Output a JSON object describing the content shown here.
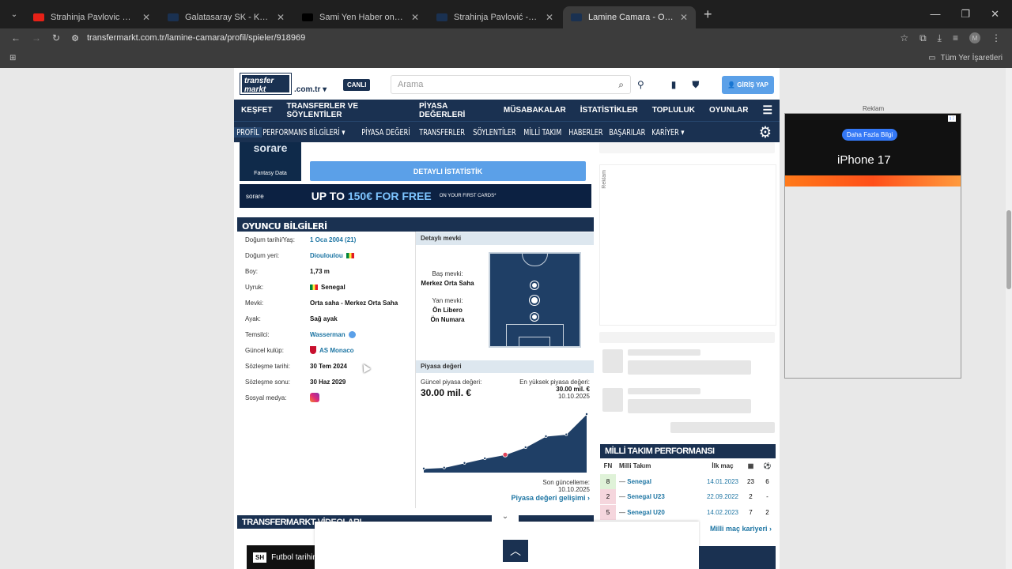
{
  "browser": {
    "tabs": [
      {
        "title": "Strahinja Pavlovic ● Welcome to",
        "fav_color": "#e62117",
        "active": false
      },
      {
        "title": "Galatasaray SK - Kulüp profili |",
        "fav_color": "#1a3151",
        "active": false
      },
      {
        "title": "Sami Yen Haber on X: \"Galatasa",
        "fav_color": "#000000",
        "active": false
      },
      {
        "title": "Strahinja Pavlović - Oyuncu pro",
        "fav_color": "#1a3151",
        "active": false
      },
      {
        "title": "Lamine Camara - Oyuncu profi",
        "fav_color": "#1a3151",
        "active": true
      }
    ],
    "url": "transfermarkt.com.tr/lamine-camara/profil/spieler/918969",
    "bookmarks_label": "Tüm Yer İşaretleri",
    "profile_initial": "M"
  },
  "header": {
    "logo_line1": "transfer",
    "logo_line2": "markt",
    "domain": ".com.tr",
    "live_badge": "CANLI",
    "search_placeholder": "Arama",
    "login_label": "GİRİŞ YAP"
  },
  "nav_main": [
    "KEŞFET",
    "TRANSFERLER VE SÖYLENTİLER",
    "PİYASA DEĞERLERİ",
    "MÜSABAKALAR",
    "İSTATİSTİKLER",
    "TOPLULUK",
    "OYUNLAR"
  ],
  "nav_sub": [
    "PROFİL",
    "PERFORMANS BİLGİLERİ ▾",
    "PİYASA DEĞERİ",
    "TRANSFERLER",
    "SÖYLENTİLER",
    "MİLLİ TAKIM",
    "HABERLER",
    "BAŞARILAR",
    "KARİYER ▾"
  ],
  "sorare": {
    "card_title": "sorare",
    "card_sub": "Fantasy Data",
    "stats_button": "DETAYLI İSTATİSTİK",
    "banner_brand": "sorare",
    "banner_promo_a": "UP TO ",
    "banner_promo_b": "150€ FOR FREE",
    "banner_sub": "ON YOUR FIRST CARDS*"
  },
  "player_info": {
    "title": "OYUNCU BİLGİLERİ",
    "rows": [
      {
        "k": "Doğum tarihi/Yaş:",
        "v": "1 Oca 2004 (21)",
        "link": true
      },
      {
        "k": "Doğum yeri:",
        "v": "Diouloulou",
        "link": true
      },
      {
        "k": "Boy:",
        "v": "1,73 m",
        "link": false
      },
      {
        "k": "Uyruk:",
        "v": "Senegal",
        "link": false
      },
      {
        "k": "Mevki:",
        "v": "Orta saha - Merkez Orta Saha",
        "link": false
      },
      {
        "k": "Ayak:",
        "v": "Sağ ayak",
        "link": false
      },
      {
        "k": "Temsilci:",
        "v": "Wasserman",
        "link": true
      },
      {
        "k": "Güncel kulüp:",
        "v": "AS Monaco",
        "link": true
      },
      {
        "k": "Sözleşme tarihi:",
        "v": "30 Tem 2024",
        "link": false
      },
      {
        "k": "Sözleşme sonu:",
        "v": "30 Haz 2029",
        "link": false
      },
      {
        "k": "Sosyal medya:",
        "v": "",
        "link": false
      }
    ]
  },
  "position": {
    "title": "Detaylı mevki",
    "main_label": "Baş mevki:",
    "main_value": "Merkez Orta Saha",
    "side_label": "Yan mevki:",
    "side_values": [
      "Ön Libero",
      "Ön Numara"
    ]
  },
  "market_value": {
    "title": "Piyasa değeri",
    "current_label": "Güncel piyasa değeri:",
    "current_value": "30.00 mil. €",
    "highest_label": "En yüksek piyasa değeri:",
    "highest_value": "30.00 mil. €",
    "highest_date": "10.10.2025",
    "updated": "Son güncelleme: 10.10.2025",
    "link": "Piyasa değeri gelişimi"
  },
  "chart_data": {
    "type": "area",
    "x": [
      0,
      1,
      2,
      3,
      4,
      5,
      6,
      7,
      8
    ],
    "values": [
      0.5,
      1,
      3.5,
      6,
      8,
      12,
      18,
      19,
      30
    ],
    "ylim": [
      0,
      30
    ],
    "highlight_index": 4,
    "colors": {
      "fill": "#1f3f66",
      "line": "#ffffff",
      "highlight": "#e0445a"
    }
  },
  "national": {
    "title": "MİLLİ TAKIM PERFORMANSI",
    "headers": [
      "FN",
      "Milli Takım",
      "İlk maç"
    ],
    "rows": [
      {
        "fn": "8",
        "team": "Senegal",
        "date": "14.01.2023",
        "apps": "23",
        "goals": "6",
        "tone": "green"
      },
      {
        "fn": "2",
        "team": "Senegal U23",
        "date": "22.09.2022",
        "apps": "2",
        "goals": "-",
        "tone": "red"
      },
      {
        "fn": "5",
        "team": "Senegal U20",
        "date": "14.02.2023",
        "apps": "7",
        "goals": "2",
        "tone": "red"
      }
    ],
    "link": "Milli maç kariyeri"
  },
  "videos": {
    "title": "TRANSFERMARKT VİDEOLARI",
    "thumb_label": "Futbol tarihin"
  },
  "ads": {
    "label": "Reklam",
    "cta": "Daha Fazla Bilgi",
    "product": "iPhone 17",
    "inline_label": "Reklam"
  }
}
